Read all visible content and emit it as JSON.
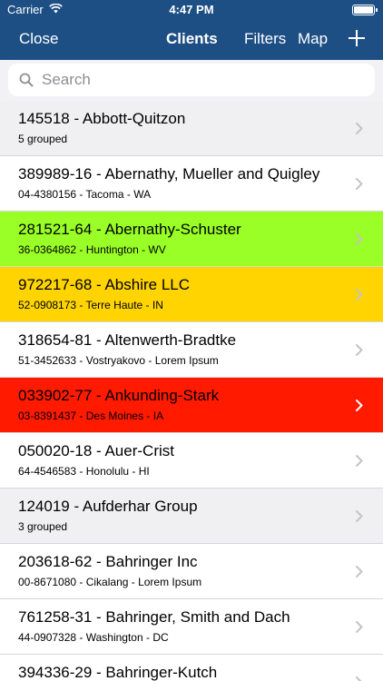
{
  "status_bar": {
    "carrier": "Carrier",
    "time": "4:47 PM"
  },
  "nav": {
    "close_label": "Close",
    "title": "Clients",
    "filters_label": "Filters",
    "map_label": "Map"
  },
  "search": {
    "placeholder": "Search"
  },
  "colors": {
    "header": "#1e4f84",
    "grouped": "#f0f0f2",
    "green": "#99ff26",
    "yellow": "#ffd400",
    "red": "#ff1a00",
    "white": "#ffffff"
  },
  "clients": [
    {
      "title": "145518 - Abbott-Quitzon",
      "subtitle": "5 grouped",
      "color": "#f0f0f2"
    },
    {
      "title": "389989-16 - Abernathy, Mueller and Quigley",
      "subtitle": "04-4380156 - Tacoma - WA",
      "color": "#ffffff"
    },
    {
      "title": "281521-64 - Abernathy-Schuster",
      "subtitle": "36-0364862 - Huntington - WV",
      "color": "#99ff26"
    },
    {
      "title": "972217-68 - Abshire LLC",
      "subtitle": "52-0908173 - Terre Haute - IN",
      "color": "#ffd400"
    },
    {
      "title": "318654-81 - Altenwerth-Bradtke",
      "subtitle": "51-3452633 - Vostryakovo - Lorem Ipsum",
      "color": "#ffffff"
    },
    {
      "title": "033902-77 - Ankunding-Stark",
      "subtitle": "03-8391437 - Des Moines - IA",
      "color": "#ff1a00"
    },
    {
      "title": "050020-18 - Auer-Crist",
      "subtitle": "64-4546583 - Honolulu - HI",
      "color": "#ffffff"
    },
    {
      "title": "124019 - Aufderhar Group",
      "subtitle": "3 grouped",
      "color": "#f0f0f2"
    },
    {
      "title": "203618-62 - Bahringer Inc",
      "subtitle": "00-8671080 - Cikalang - Lorem Ipsum",
      "color": "#ffffff"
    },
    {
      "title": "761258-31 - Bahringer, Smith and Dach",
      "subtitle": "44-0907328 - Washington - DC",
      "color": "#ffffff"
    },
    {
      "title": "394336-29 - Bahringer-Kutch",
      "subtitle": "",
      "color": "#ffffff"
    }
  ]
}
